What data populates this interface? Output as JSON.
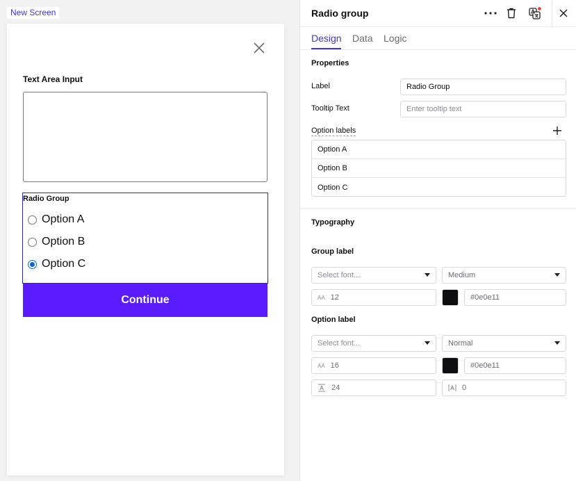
{
  "canvas": {
    "screen_tag": "New Screen",
    "text_area_label": "Text Area Input",
    "text_area_value": "",
    "radio_group": {
      "label": "Radio Group",
      "options": [
        "Option A",
        "Option B",
        "Option C"
      ],
      "selected": "Option C"
    },
    "continue_label": "Continue"
  },
  "panel": {
    "title": "Radio group",
    "icons": [
      "more-icon",
      "trash-icon",
      "translate-icon",
      "close-icon"
    ],
    "notification_color": "#e53935",
    "tabs": [
      "Design",
      "Data",
      "Logic"
    ],
    "active_tab": "Design",
    "properties": {
      "title": "Properties",
      "label_label": "Label",
      "label_value": "Radio Group",
      "tooltip_label": "Tooltip Text",
      "tooltip_placeholder": "Enter tooltip text",
      "option_labels_label": "Option labels",
      "option_labels": [
        "Option A",
        "Option B",
        "Option C"
      ]
    },
    "typography": {
      "title": "Typography",
      "group_label": {
        "title": "Group label",
        "font_placeholder": "Select font...",
        "weight": "Medium",
        "size": "12",
        "color_swatch": "#0e0e11",
        "color": "#0e0e11"
      },
      "option_label": {
        "title": "Option label",
        "font_placeholder": "Select font...",
        "weight": "Normal",
        "size": "16",
        "color_swatch": "#0e0e11",
        "color": "#0e0e11",
        "line_height": "24",
        "letter_spacing": "0"
      }
    }
  },
  "colors": {
    "accent": "#3a35e0",
    "button": "#5a1bff",
    "radio_selected": "#0b63d8"
  }
}
